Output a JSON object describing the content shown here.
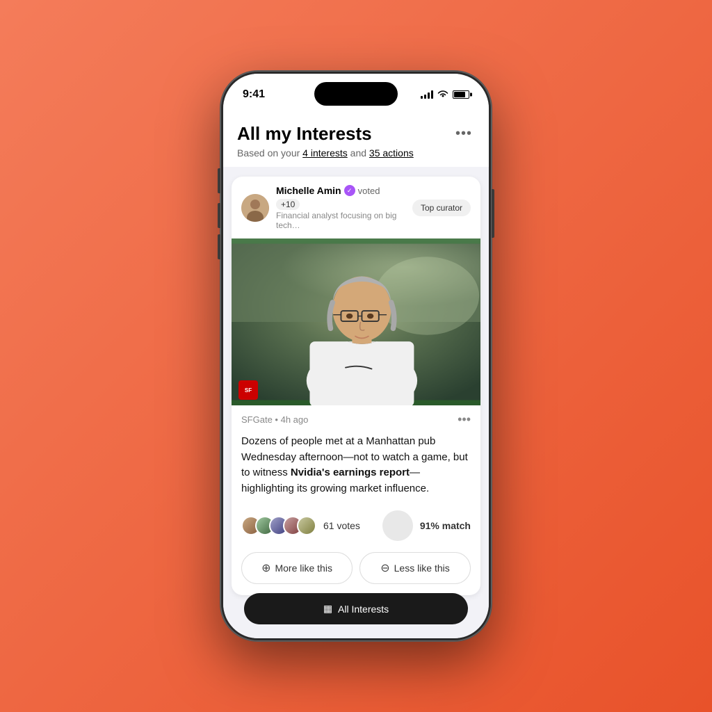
{
  "background": {
    "gradient_start": "#f47c5a",
    "gradient_end": "#e8522a"
  },
  "status_bar": {
    "time": "9:41",
    "signal_label": "signal",
    "wifi_label": "wifi",
    "battery_label": "battery"
  },
  "header": {
    "title": "All my Interests",
    "more_label": "•••",
    "subtitle_prefix": "Based on your ",
    "interests_link": "4 interests",
    "subtitle_middle": " and ",
    "actions_link": "35 actions"
  },
  "card": {
    "curator": {
      "name": "Michelle Amin",
      "verified": true,
      "action": "voted",
      "vote_count": "+10",
      "badge": "Top curator",
      "description": "Financial analyst focusing on big tech…"
    },
    "article": {
      "source": "SFGate",
      "time_ago": "4h ago",
      "body_text": "Dozens of people met at a Manhattan pub Wednesday afternoon—not to watch a game, but to witness ",
      "bold_text": "Nvidia's earnings report",
      "body_text_end": "—highlighting its growing market influence.",
      "votes_count": "61 votes",
      "match_percent": "91% match"
    },
    "actions": {
      "more_like_this": "More like this",
      "less_like_this": "Less like this",
      "more_icon": "⊕",
      "less_icon": "⊖"
    }
  },
  "bottom_bar": {
    "icon": "▦",
    "label": "All Interests"
  }
}
